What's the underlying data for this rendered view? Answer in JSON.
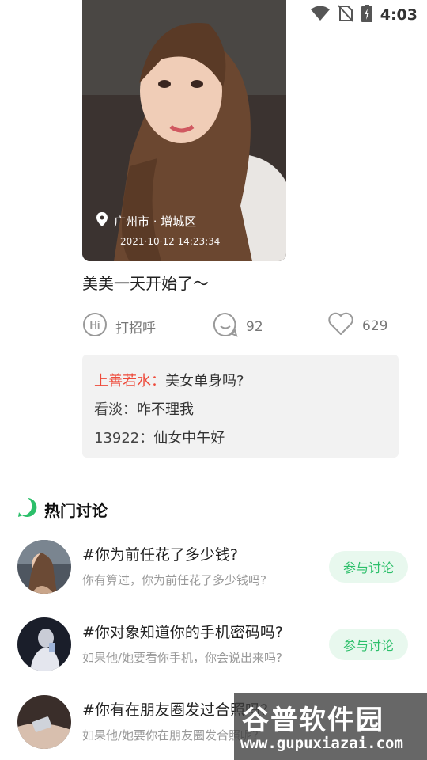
{
  "status_bar": {
    "time": "4:03"
  },
  "post": {
    "location": "广州市 · 增城区",
    "photo_time": "2021·10·12  14:23:34",
    "caption": "美美一天开始了～",
    "actions": {
      "greet_label": "打招呼",
      "comment_count": "92",
      "like_count": "629"
    },
    "comments": [
      {
        "user": "上善若水：",
        "text": "美女单身吗?",
        "highlight": true
      },
      {
        "user": "看淡：",
        "text": "咋不理我",
        "highlight": false
      },
      {
        "user": "13922：",
        "text": "仙女中午好",
        "highlight": false
      }
    ]
  },
  "hot_section": {
    "title": "热门讨论",
    "join_label": "参与讨论",
    "topics": [
      {
        "title": "#你为前任花了多少钱?",
        "subtitle": "你有算过，你为前任花了多少钱吗?"
      },
      {
        "title": "#你对象知道你的手机密码吗?",
        "subtitle": "如果他/她要看你手机，你会说出来吗?"
      },
      {
        "title": "#你有在朋友圈发过合照吗?",
        "subtitle": "如果他/她要你在朋友圈发合照呢?"
      }
    ]
  },
  "watermark": {
    "brand": "谷普软件园",
    "url": "www.gupuxiazai.com"
  },
  "colors": {
    "accent_green": "#2cbf6a",
    "highlight_red": "#ee4a3a"
  }
}
